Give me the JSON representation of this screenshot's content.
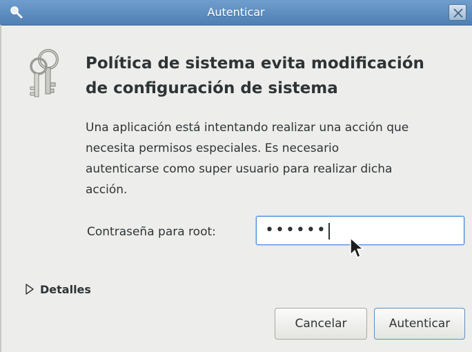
{
  "window": {
    "title": "Autenticar",
    "title_icon": "magnifier-icon",
    "close_icon": "close-icon",
    "titlebar_color": "#5a88bc"
  },
  "dialog": {
    "icon": "keys-icon",
    "heading_line1": "Política de sistema evita modificación",
    "heading_line2": "de configuración de sistema",
    "description_lines": [
      "Una aplicación está intentando realizar una acción que",
      "necesita permisos especiales. Es necesario",
      "autenticarse como super usuario para realizar dicha",
      "acción."
    ],
    "password_label": "Contraseña para root:",
    "password_value": "••••••",
    "details_label": "Detalles",
    "details_icon": "disclosure-triangle-icon"
  },
  "buttons": {
    "cancel": "Cancelar",
    "authenticate": "Autenticar"
  },
  "accent_color": "#4a90d9"
}
